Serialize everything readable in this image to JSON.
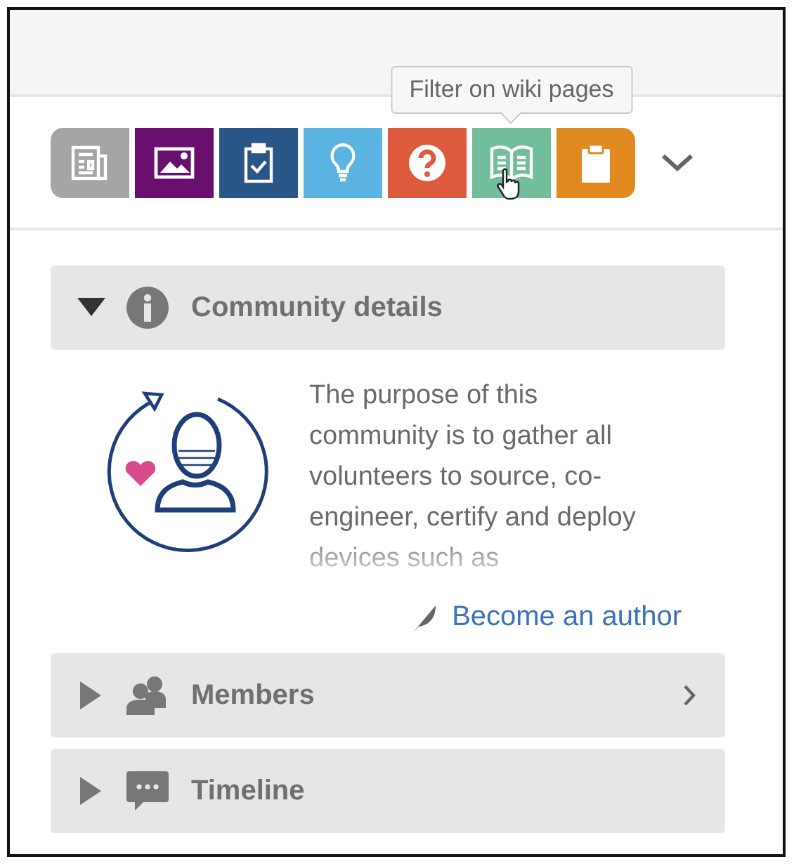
{
  "filters": [
    {
      "kind": "news",
      "color": "#a5a5a5",
      "hovered": false
    },
    {
      "kind": "image",
      "color": "#6a0f6e",
      "hovered": false
    },
    {
      "kind": "task",
      "color": "#2a5587",
      "hovered": false
    },
    {
      "kind": "idea",
      "color": "#5ab3e0",
      "hovered": false
    },
    {
      "kind": "question",
      "color": "#dd5a3c",
      "hovered": false
    },
    {
      "kind": "wiki",
      "color": "#72bd9c",
      "hovered": true,
      "tooltip": "Filter on wiki pages"
    },
    {
      "kind": "clipboard",
      "color": "#e08a20",
      "hovered": false
    }
  ],
  "sections": [
    {
      "kind": "info",
      "title": "Community details",
      "expanded": true,
      "has_more": false,
      "description": "The purpose of this community is to gather all volunteers to source, co-engineer, certify and deploy devices such as",
      "link": "Become an author"
    },
    {
      "kind": "members",
      "title": "Members",
      "expanded": false,
      "has_more": true
    },
    {
      "kind": "timeline",
      "title": "Timeline",
      "expanded": false,
      "has_more": false
    }
  ]
}
